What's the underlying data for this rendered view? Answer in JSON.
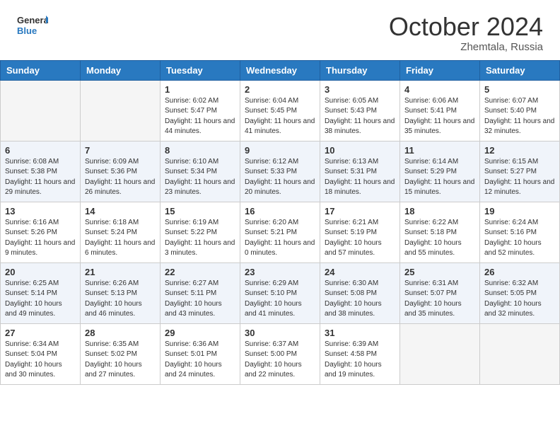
{
  "header": {
    "logo_general": "General",
    "logo_blue": "Blue",
    "month": "October 2024",
    "location": "Zhemtala, Russia"
  },
  "weekdays": [
    "Sunday",
    "Monday",
    "Tuesday",
    "Wednesday",
    "Thursday",
    "Friday",
    "Saturday"
  ],
  "weeks": [
    [
      {
        "day": "",
        "info": ""
      },
      {
        "day": "",
        "info": ""
      },
      {
        "day": "1",
        "info": "Sunrise: 6:02 AM\nSunset: 5:47 PM\nDaylight: 11 hours and 44 minutes."
      },
      {
        "day": "2",
        "info": "Sunrise: 6:04 AM\nSunset: 5:45 PM\nDaylight: 11 hours and 41 minutes."
      },
      {
        "day": "3",
        "info": "Sunrise: 6:05 AM\nSunset: 5:43 PM\nDaylight: 11 hours and 38 minutes."
      },
      {
        "day": "4",
        "info": "Sunrise: 6:06 AM\nSunset: 5:41 PM\nDaylight: 11 hours and 35 minutes."
      },
      {
        "day": "5",
        "info": "Sunrise: 6:07 AM\nSunset: 5:40 PM\nDaylight: 11 hours and 32 minutes."
      }
    ],
    [
      {
        "day": "6",
        "info": "Sunrise: 6:08 AM\nSunset: 5:38 PM\nDaylight: 11 hours and 29 minutes."
      },
      {
        "day": "7",
        "info": "Sunrise: 6:09 AM\nSunset: 5:36 PM\nDaylight: 11 hours and 26 minutes."
      },
      {
        "day": "8",
        "info": "Sunrise: 6:10 AM\nSunset: 5:34 PM\nDaylight: 11 hours and 23 minutes."
      },
      {
        "day": "9",
        "info": "Sunrise: 6:12 AM\nSunset: 5:33 PM\nDaylight: 11 hours and 20 minutes."
      },
      {
        "day": "10",
        "info": "Sunrise: 6:13 AM\nSunset: 5:31 PM\nDaylight: 11 hours and 18 minutes."
      },
      {
        "day": "11",
        "info": "Sunrise: 6:14 AM\nSunset: 5:29 PM\nDaylight: 11 hours and 15 minutes."
      },
      {
        "day": "12",
        "info": "Sunrise: 6:15 AM\nSunset: 5:27 PM\nDaylight: 11 hours and 12 minutes."
      }
    ],
    [
      {
        "day": "13",
        "info": "Sunrise: 6:16 AM\nSunset: 5:26 PM\nDaylight: 11 hours and 9 minutes."
      },
      {
        "day": "14",
        "info": "Sunrise: 6:18 AM\nSunset: 5:24 PM\nDaylight: 11 hours and 6 minutes."
      },
      {
        "day": "15",
        "info": "Sunrise: 6:19 AM\nSunset: 5:22 PM\nDaylight: 11 hours and 3 minutes."
      },
      {
        "day": "16",
        "info": "Sunrise: 6:20 AM\nSunset: 5:21 PM\nDaylight: 11 hours and 0 minutes."
      },
      {
        "day": "17",
        "info": "Sunrise: 6:21 AM\nSunset: 5:19 PM\nDaylight: 10 hours and 57 minutes."
      },
      {
        "day": "18",
        "info": "Sunrise: 6:22 AM\nSunset: 5:18 PM\nDaylight: 10 hours and 55 minutes."
      },
      {
        "day": "19",
        "info": "Sunrise: 6:24 AM\nSunset: 5:16 PM\nDaylight: 10 hours and 52 minutes."
      }
    ],
    [
      {
        "day": "20",
        "info": "Sunrise: 6:25 AM\nSunset: 5:14 PM\nDaylight: 10 hours and 49 minutes."
      },
      {
        "day": "21",
        "info": "Sunrise: 6:26 AM\nSunset: 5:13 PM\nDaylight: 10 hours and 46 minutes."
      },
      {
        "day": "22",
        "info": "Sunrise: 6:27 AM\nSunset: 5:11 PM\nDaylight: 10 hours and 43 minutes."
      },
      {
        "day": "23",
        "info": "Sunrise: 6:29 AM\nSunset: 5:10 PM\nDaylight: 10 hours and 41 minutes."
      },
      {
        "day": "24",
        "info": "Sunrise: 6:30 AM\nSunset: 5:08 PM\nDaylight: 10 hours and 38 minutes."
      },
      {
        "day": "25",
        "info": "Sunrise: 6:31 AM\nSunset: 5:07 PM\nDaylight: 10 hours and 35 minutes."
      },
      {
        "day": "26",
        "info": "Sunrise: 6:32 AM\nSunset: 5:05 PM\nDaylight: 10 hours and 32 minutes."
      }
    ],
    [
      {
        "day": "27",
        "info": "Sunrise: 6:34 AM\nSunset: 5:04 PM\nDaylight: 10 hours and 30 minutes."
      },
      {
        "day": "28",
        "info": "Sunrise: 6:35 AM\nSunset: 5:02 PM\nDaylight: 10 hours and 27 minutes."
      },
      {
        "day": "29",
        "info": "Sunrise: 6:36 AM\nSunset: 5:01 PM\nDaylight: 10 hours and 24 minutes."
      },
      {
        "day": "30",
        "info": "Sunrise: 6:37 AM\nSunset: 5:00 PM\nDaylight: 10 hours and 22 minutes."
      },
      {
        "day": "31",
        "info": "Sunrise: 6:39 AM\nSunset: 4:58 PM\nDaylight: 10 hours and 19 minutes."
      },
      {
        "day": "",
        "info": ""
      },
      {
        "day": "",
        "info": ""
      }
    ]
  ]
}
